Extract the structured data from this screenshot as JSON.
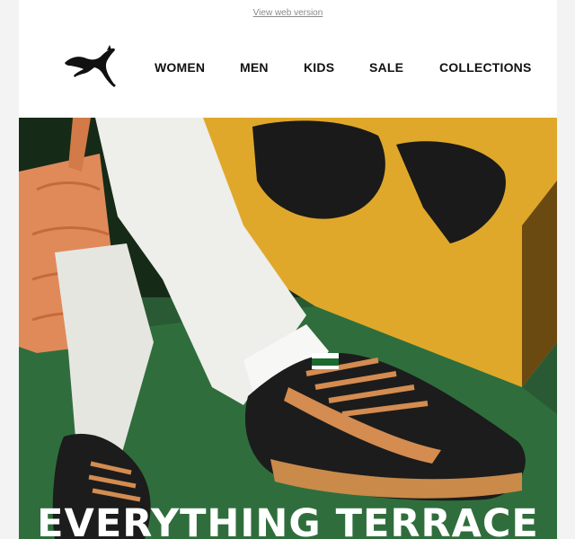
{
  "header": {
    "web_version_link": "View web version",
    "logo": {
      "icon": "puma-cat-logo",
      "alt": "PUMA"
    }
  },
  "nav": {
    "items": [
      {
        "label": "WOMEN"
      },
      {
        "label": "MEN"
      },
      {
        "label": "KIDS"
      },
      {
        "label": "SALE"
      },
      {
        "label": "COLLECTIONS"
      }
    ]
  },
  "hero": {
    "image": "Person in white jeans wearing black suede PUMA sneakers with tan laces, holding a quilted orange bag, seated against a yellow sign",
    "headline": "EVERYTHING TERRACE"
  }
}
